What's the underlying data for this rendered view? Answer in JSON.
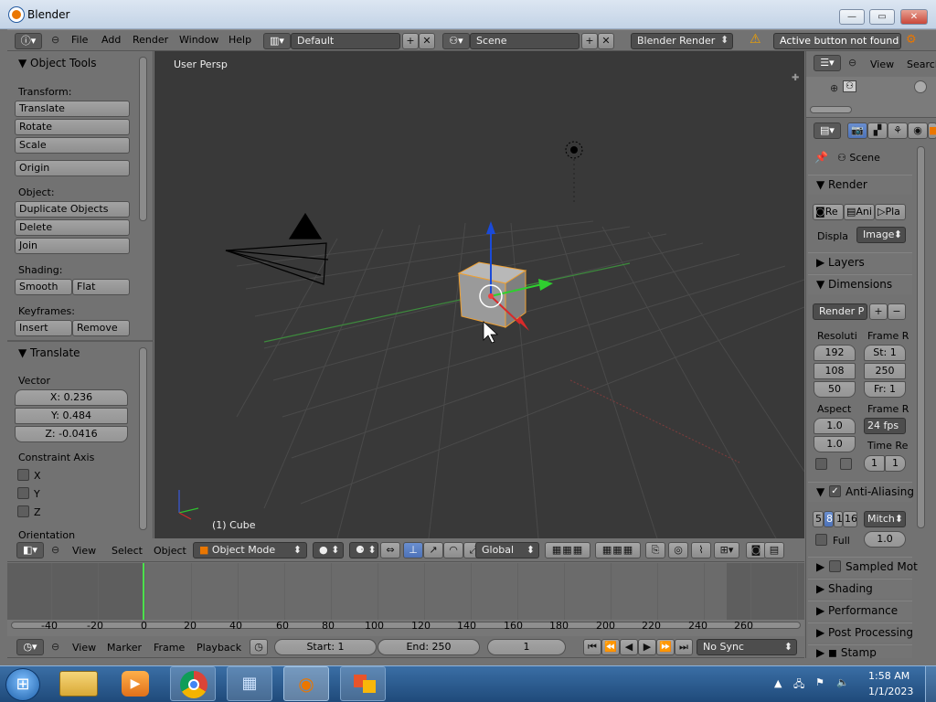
{
  "window": {
    "title": "Blender"
  },
  "info_header": {
    "menus": [
      "File",
      "Add",
      "Render",
      "Window",
      "Help"
    ],
    "layout": "Default",
    "scene": "Scene",
    "engine": "Blender Render",
    "report": "Active button not found"
  },
  "tool_panel": {
    "title": "Object Tools",
    "transform_label": "Transform:",
    "translate": "Translate",
    "rotate": "Rotate",
    "scale": "Scale",
    "origin": "Origin",
    "object_label": "Object:",
    "duplicate": "Duplicate Objects",
    "delete": "Delete",
    "join": "Join",
    "shading_label": "Shading:",
    "smooth": "Smooth",
    "flat": "Flat",
    "keyframes_label": "Keyframes:",
    "insert": "Insert",
    "remove": "Remove"
  },
  "operator_panel": {
    "title": "Translate",
    "vector_label": "Vector",
    "x": "X: 0.236",
    "y": "Y: 0.484",
    "z": "Z: -0.0416",
    "constraint_label": "Constraint Axis",
    "cx": "X",
    "cy": "Y",
    "cz": "Z",
    "orientation_label": "Orientation"
  },
  "viewport": {
    "view_label": "User Persp",
    "object_label": "(1) Cube"
  },
  "view3d_header": {
    "menus": [
      "View",
      "Select",
      "Object"
    ],
    "mode": "Object Mode",
    "orientation": "Global"
  },
  "timeline": {
    "ticks": [
      "-40",
      "-20",
      "0",
      "20",
      "40",
      "60",
      "80",
      "100",
      "120",
      "140",
      "160",
      "180",
      "200",
      "220",
      "240",
      "260"
    ],
    "menus": [
      "View",
      "Marker",
      "Frame",
      "Playback"
    ],
    "start": "Start: 1",
    "end": "End: 250",
    "current": "1",
    "sync": "No Sync"
  },
  "outliner": {
    "view": "View",
    "search": "Search"
  },
  "properties": {
    "scene": "Scene",
    "render": "Render",
    "render_btn": "Re",
    "anim_btn": "Ani",
    "play_btn": "Pla",
    "display_label": "Displa",
    "display_val": "Image",
    "layers": "Layers",
    "dimensions": "Dimensions",
    "preset": "Render P",
    "resolution_label": "Resoluti",
    "framerange_label": "Frame R",
    "res_x": "192",
    "res_y": "108",
    "res_pct": "50",
    "start_f": "St: 1",
    "end_f": "250",
    "step_f": "Fr: 1",
    "aspect_label": "Aspect",
    "framerate_label": "Frame R",
    "asp_x": "1.0",
    "asp_y": "1.0",
    "fps": "24 fps",
    "timere_label": "Time Re",
    "tr_a": "1",
    "tr_b": "1",
    "aa": "Anti-Aliasing",
    "aa_5": "5",
    "aa_8": "8",
    "aa_11": "1",
    "aa_16": "16",
    "aa_filter": "Mitch",
    "full": "Full",
    "full_val": "1.0",
    "sampled": "Sampled Mot",
    "shading": "Shading",
    "performance": "Performance",
    "post": "Post Processing",
    "stamp": "Stamp"
  },
  "taskbar": {
    "time": "1:58 AM",
    "date": "1/1/2023"
  },
  "colors": {
    "accent": "#5680c2",
    "viewport": "#393939",
    "panel": "#727272"
  }
}
